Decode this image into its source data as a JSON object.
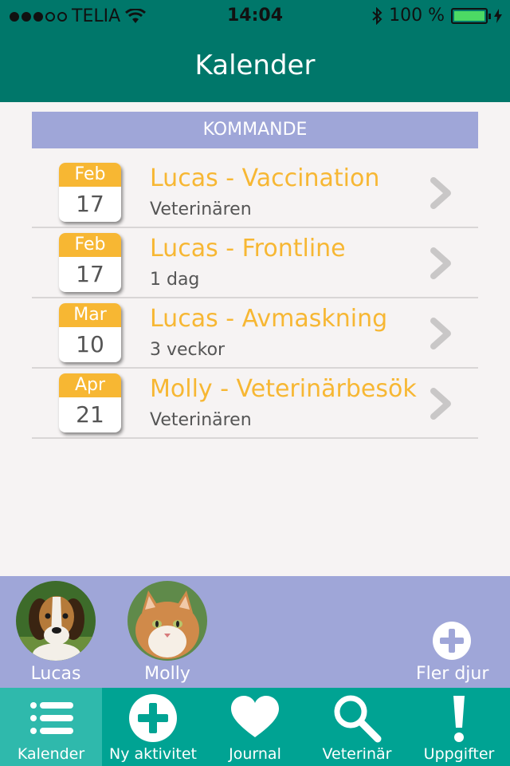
{
  "status": {
    "carrier": "TELIA",
    "time": "14:04",
    "battery": "100 %",
    "signal_bars_filled": 3,
    "signal_bars_total": 5
  },
  "navbar": {
    "title": "Kalender"
  },
  "section": {
    "title": "KOMMANDE"
  },
  "events": [
    {
      "month": "Feb",
      "day": "17",
      "title": "Lucas - Vaccination",
      "subtitle": "Veterinären"
    },
    {
      "month": "Feb",
      "day": "17",
      "title": "Lucas - Frontline",
      "subtitle": "1 dag"
    },
    {
      "month": "Mar",
      "day": "10",
      "title": "Lucas - Avmaskning",
      "subtitle": "3 veckor"
    },
    {
      "month": "Apr",
      "day": "21",
      "title": "Molly - Veterinärbesök",
      "subtitle": "Veterinären"
    }
  ],
  "pets": [
    {
      "name": "Lucas"
    },
    {
      "name": "Molly"
    }
  ],
  "more_pets_label": "Fler djur",
  "tabs": [
    {
      "label": "Kalender",
      "icon": "list-icon",
      "active": true
    },
    {
      "label": "Ny aktivitet",
      "icon": "add-circle-icon",
      "active": false
    },
    {
      "label": "Journal",
      "icon": "heart-icon",
      "active": false
    },
    {
      "label": "Veterinär",
      "icon": "search-icon",
      "active": false
    },
    {
      "label": "Uppgifter",
      "icon": "exclamation-icon",
      "active": false
    }
  ],
  "colors": {
    "primary": "#00776a",
    "tabbar": "#00a393",
    "tab_active": "#2fb9ac",
    "section": "#9fa6d8",
    "accent": "#f7b733",
    "background": "#f6f3f3"
  }
}
